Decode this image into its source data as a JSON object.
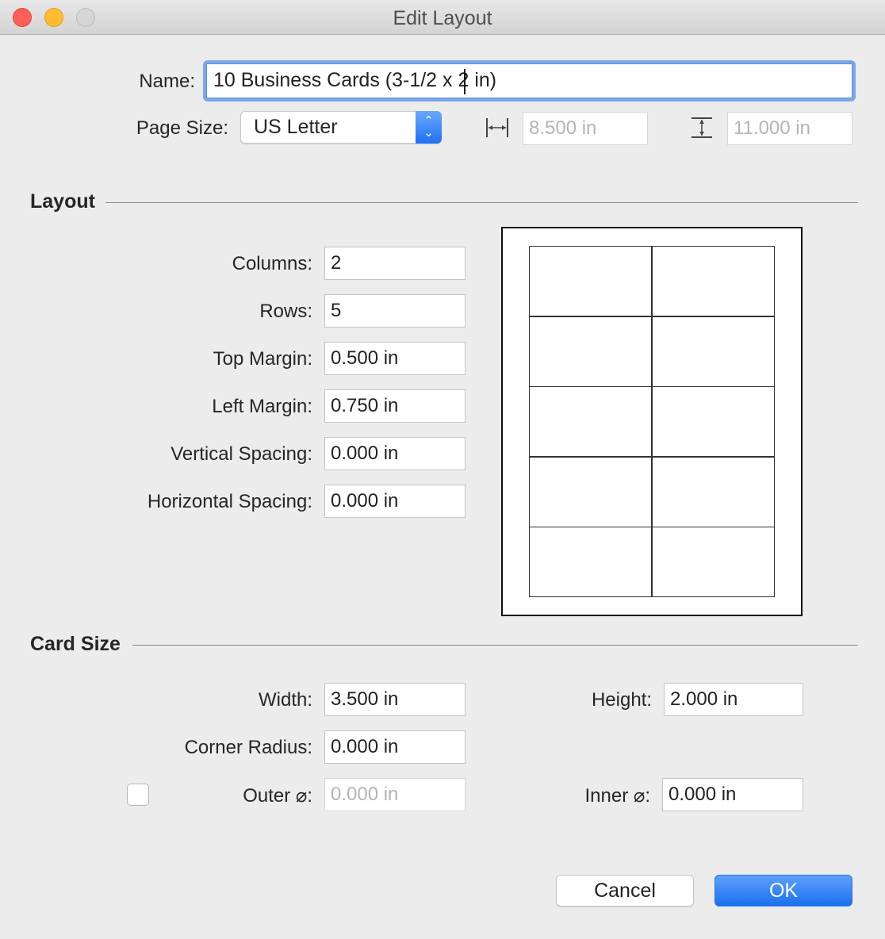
{
  "window": {
    "title": "Edit Layout",
    "controls": [
      "close",
      "minimize",
      "zoom"
    ]
  },
  "header": {
    "name_label": "Name:",
    "name_value": "10 Business Cards (3-1/2 x 2 in)",
    "page_size_label": "Page Size:",
    "page_size_value": "US Letter",
    "page_width_icon": "horizontal-dimension-icon",
    "page_width_value": "8.500 in",
    "page_height_icon": "vertical-dimension-icon",
    "page_height_value": "11.000 in"
  },
  "layout": {
    "title": "Layout",
    "fields": [
      {
        "label": "Columns:",
        "value": "2"
      },
      {
        "label": "Rows:",
        "value": "5"
      },
      {
        "label": "Top Margin:",
        "value": "0.500 in"
      },
      {
        "label": "Left Margin:",
        "value": "0.750 in"
      },
      {
        "label": "Vertical Spacing:",
        "value": "0.000 in"
      },
      {
        "label": "Horizontal Spacing:",
        "value": "0.000 in"
      }
    ],
    "preview": {
      "columns": 2,
      "rows": 5,
      "page_width_in": 8.5,
      "page_height_in": 11.0,
      "top_margin_in": 0.5,
      "left_margin_in": 0.75,
      "card_width_in": 3.5,
      "card_height_in": 2.0
    }
  },
  "card_size": {
    "title": "Card Size",
    "width_label": "Width:",
    "width_value": "3.500 in",
    "height_label": "Height:",
    "height_value": "2.000 in",
    "corner_radius_label": "Corner Radius:",
    "corner_radius_value": "0.000 in",
    "outer_label": "Outer ⌀:",
    "outer_value": "0.000 in",
    "outer_checked": false,
    "inner_label": "Inner ⌀:",
    "inner_value": "0.000 in"
  },
  "buttons": {
    "cancel": "Cancel",
    "ok": "OK"
  }
}
